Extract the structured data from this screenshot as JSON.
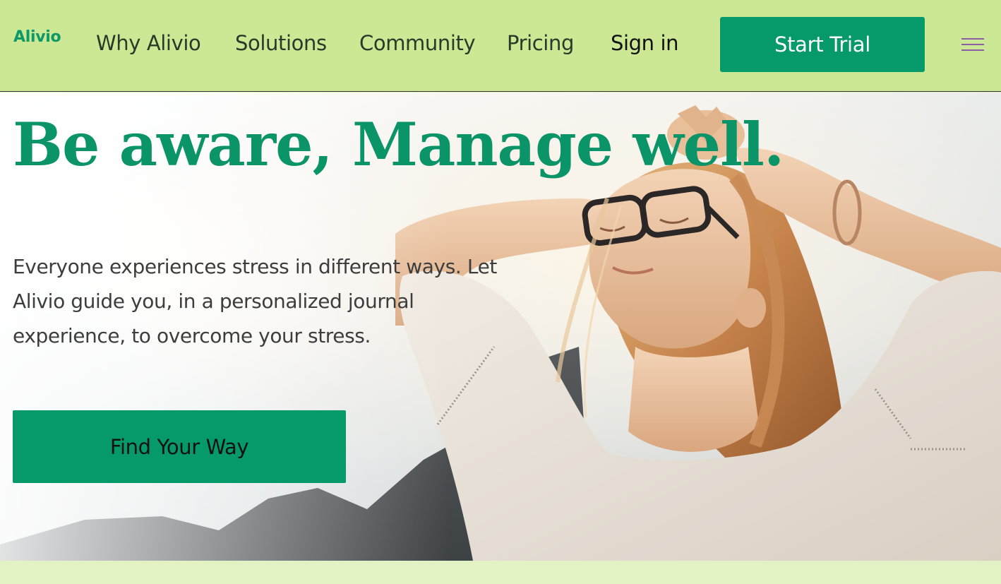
{
  "header": {
    "logo": "Alivio",
    "nav": [
      {
        "label": "Why Alivio"
      },
      {
        "label": "Solutions"
      },
      {
        "label": "Community"
      },
      {
        "label": "Pricing"
      },
      {
        "label": "Sign in"
      }
    ],
    "cta_label": "Start Trial",
    "menu_icon": "hamburger-menu-icon"
  },
  "hero": {
    "title": "Be aware, Manage well.",
    "description": "Everyone experiences stress in different ways. Let Alivio guide you, in a personalized journal experience, to overcome your stress.",
    "cta_label": "Find Your Way",
    "image": "woman-relaxing-photo"
  },
  "colors": {
    "header_bg": "#cde894",
    "accent": "#069a6b",
    "title": "#0a9467",
    "page_bg": "#e2f2c4",
    "menu_icon": "#8b5ea8"
  }
}
